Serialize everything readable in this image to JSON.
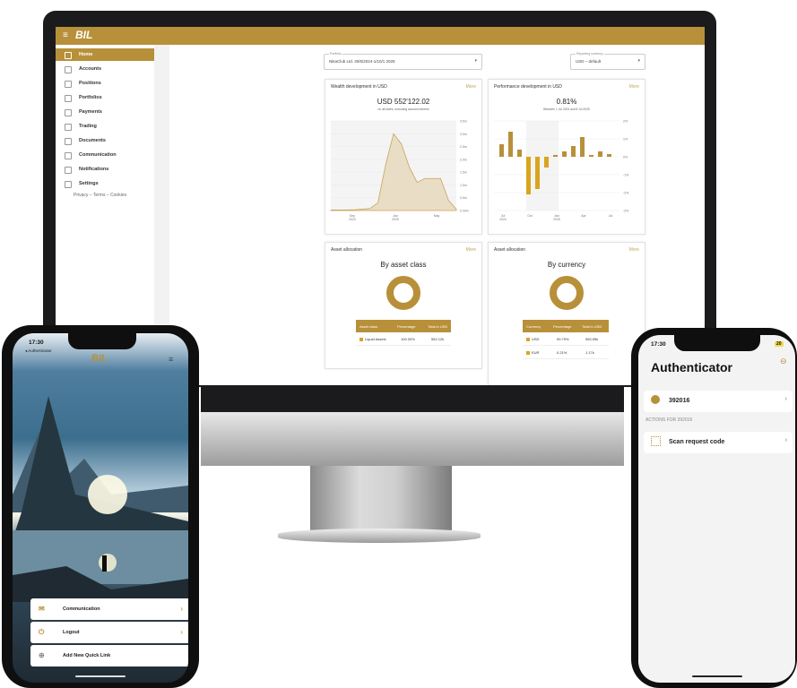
{
  "monitor_app": {
    "logo": "BIL",
    "sidebar": [
      {
        "label": "Home",
        "icon": "home-icon",
        "active": true
      },
      {
        "label": "Accounts",
        "icon": "accounts-icon"
      },
      {
        "label": "Positions",
        "icon": "positions-icon"
      },
      {
        "label": "Portfolios",
        "icon": "portfolios-icon"
      },
      {
        "label": "Payments",
        "icon": "payments-icon"
      },
      {
        "label": "Trading",
        "icon": "trading-icon"
      },
      {
        "label": "Documents",
        "icon": "documents-icon"
      },
      {
        "label": "Communication",
        "icon": "communication-icon"
      },
      {
        "label": "Notifications",
        "icon": "notifications-icon"
      },
      {
        "label": "Settings",
        "icon": "settings-icon"
      }
    ],
    "footer_links": "Privacy – Terms – Cookies",
    "portfolio_select": {
      "label": "Portfolio",
      "value": "NikaClub Ltd. 30/6/2024-1/10/1 2025"
    },
    "currency_select": {
      "label": "Reporting currency",
      "value": "USD – default"
    },
    "wealth_card": {
      "title": "Wealth development in USD",
      "more": "More",
      "amount": "USD 552'122.02",
      "sub": "on all dates, excluding accrued interest"
    },
    "performance_card": {
      "title": "Performance development in USD",
      "more": "More",
      "amount": "0.81%",
      "sub": "Between 1 Jul 2024 and 8 Jul 2025"
    },
    "alloc_class_card": {
      "title": "Asset allocation",
      "more": "More",
      "heading": "By asset class",
      "headers": [
        "Asset class",
        "Percentage",
        "Total in USD"
      ],
      "rows": [
        [
          "Liquid Assets",
          "100.00%",
          "552.12k"
        ]
      ]
    },
    "alloc_currency_card": {
      "title": "Asset allocation",
      "more": "More",
      "heading": "By currency",
      "headers": [
        "Currency",
        "Percentage",
        "Total in USD"
      ],
      "rows": [
        [
          "USD",
          "99.79%",
          "550.95k"
        ],
        [
          "EUR",
          "0.21%",
          "1.17k"
        ]
      ]
    }
  },
  "chart_data": [
    {
      "type": "area",
      "title": "Wealth development in USD",
      "x_ticks": [
        "Sep\n2024",
        "Jan\n2025",
        "May"
      ],
      "y_ticks": [
        "3.5m",
        "3.0m",
        "2.5m",
        "2.0m",
        "1.5m",
        "1.0m",
        "0.5m",
        "0.00m"
      ],
      "ylim": [
        0,
        3.5
      ],
      "values": [
        0.02,
        0.02,
        0.02,
        0.03,
        0.05,
        0.08,
        0.3,
        1.8,
        3.0,
        2.6,
        1.7,
        1.1,
        1.25,
        1.25,
        1.25,
        0.4,
        0.05
      ],
      "color": "#e9ddc5"
    },
    {
      "type": "bar",
      "title": "Performance development in USD",
      "x_ticks": [
        "Jul\n2024",
        "Oct",
        "Jan\n2025",
        "Apr",
        "Jul"
      ],
      "y_ticks": [
        "2%",
        "1%",
        "0%",
        "-1%",
        "-2%",
        "-3%"
      ],
      "ylim": [
        -3,
        2
      ],
      "values": [
        0.7,
        1.4,
        0.4,
        -2.1,
        -1.8,
        -0.6,
        0.1,
        0.3,
        0.6,
        1.1,
        0.1,
        0.3,
        0.15
      ],
      "colors": [
        "#b8903a",
        "#b8903a",
        "#b8903a",
        "#d9a520",
        "#d9a520",
        "#d9a520",
        "#b8903a",
        "#b8903a",
        "#b8903a",
        "#b8903a",
        "#b8903a",
        "#b8903a",
        "#b8903a"
      ]
    }
  ],
  "left_phone": {
    "time": "17:30",
    "back_label": "◂ Authenticator",
    "logo": "BIL",
    "quick_links": [
      {
        "label": "Communication",
        "icon": "envelope-icon"
      },
      {
        "label": "Logout",
        "icon": "power-icon"
      },
      {
        "label": "Add New Quick Link",
        "icon": "plus-circle-icon"
      }
    ]
  },
  "right_phone": {
    "time": "17:30",
    "battery": "20",
    "title": "Authenticator",
    "user_id": "392016",
    "section_label": "ACTIONS FOR 392016",
    "action": "Scan request code"
  },
  "colors": {
    "brand_gold": "#b8903a",
    "accent_yellow": "#d9a520"
  }
}
